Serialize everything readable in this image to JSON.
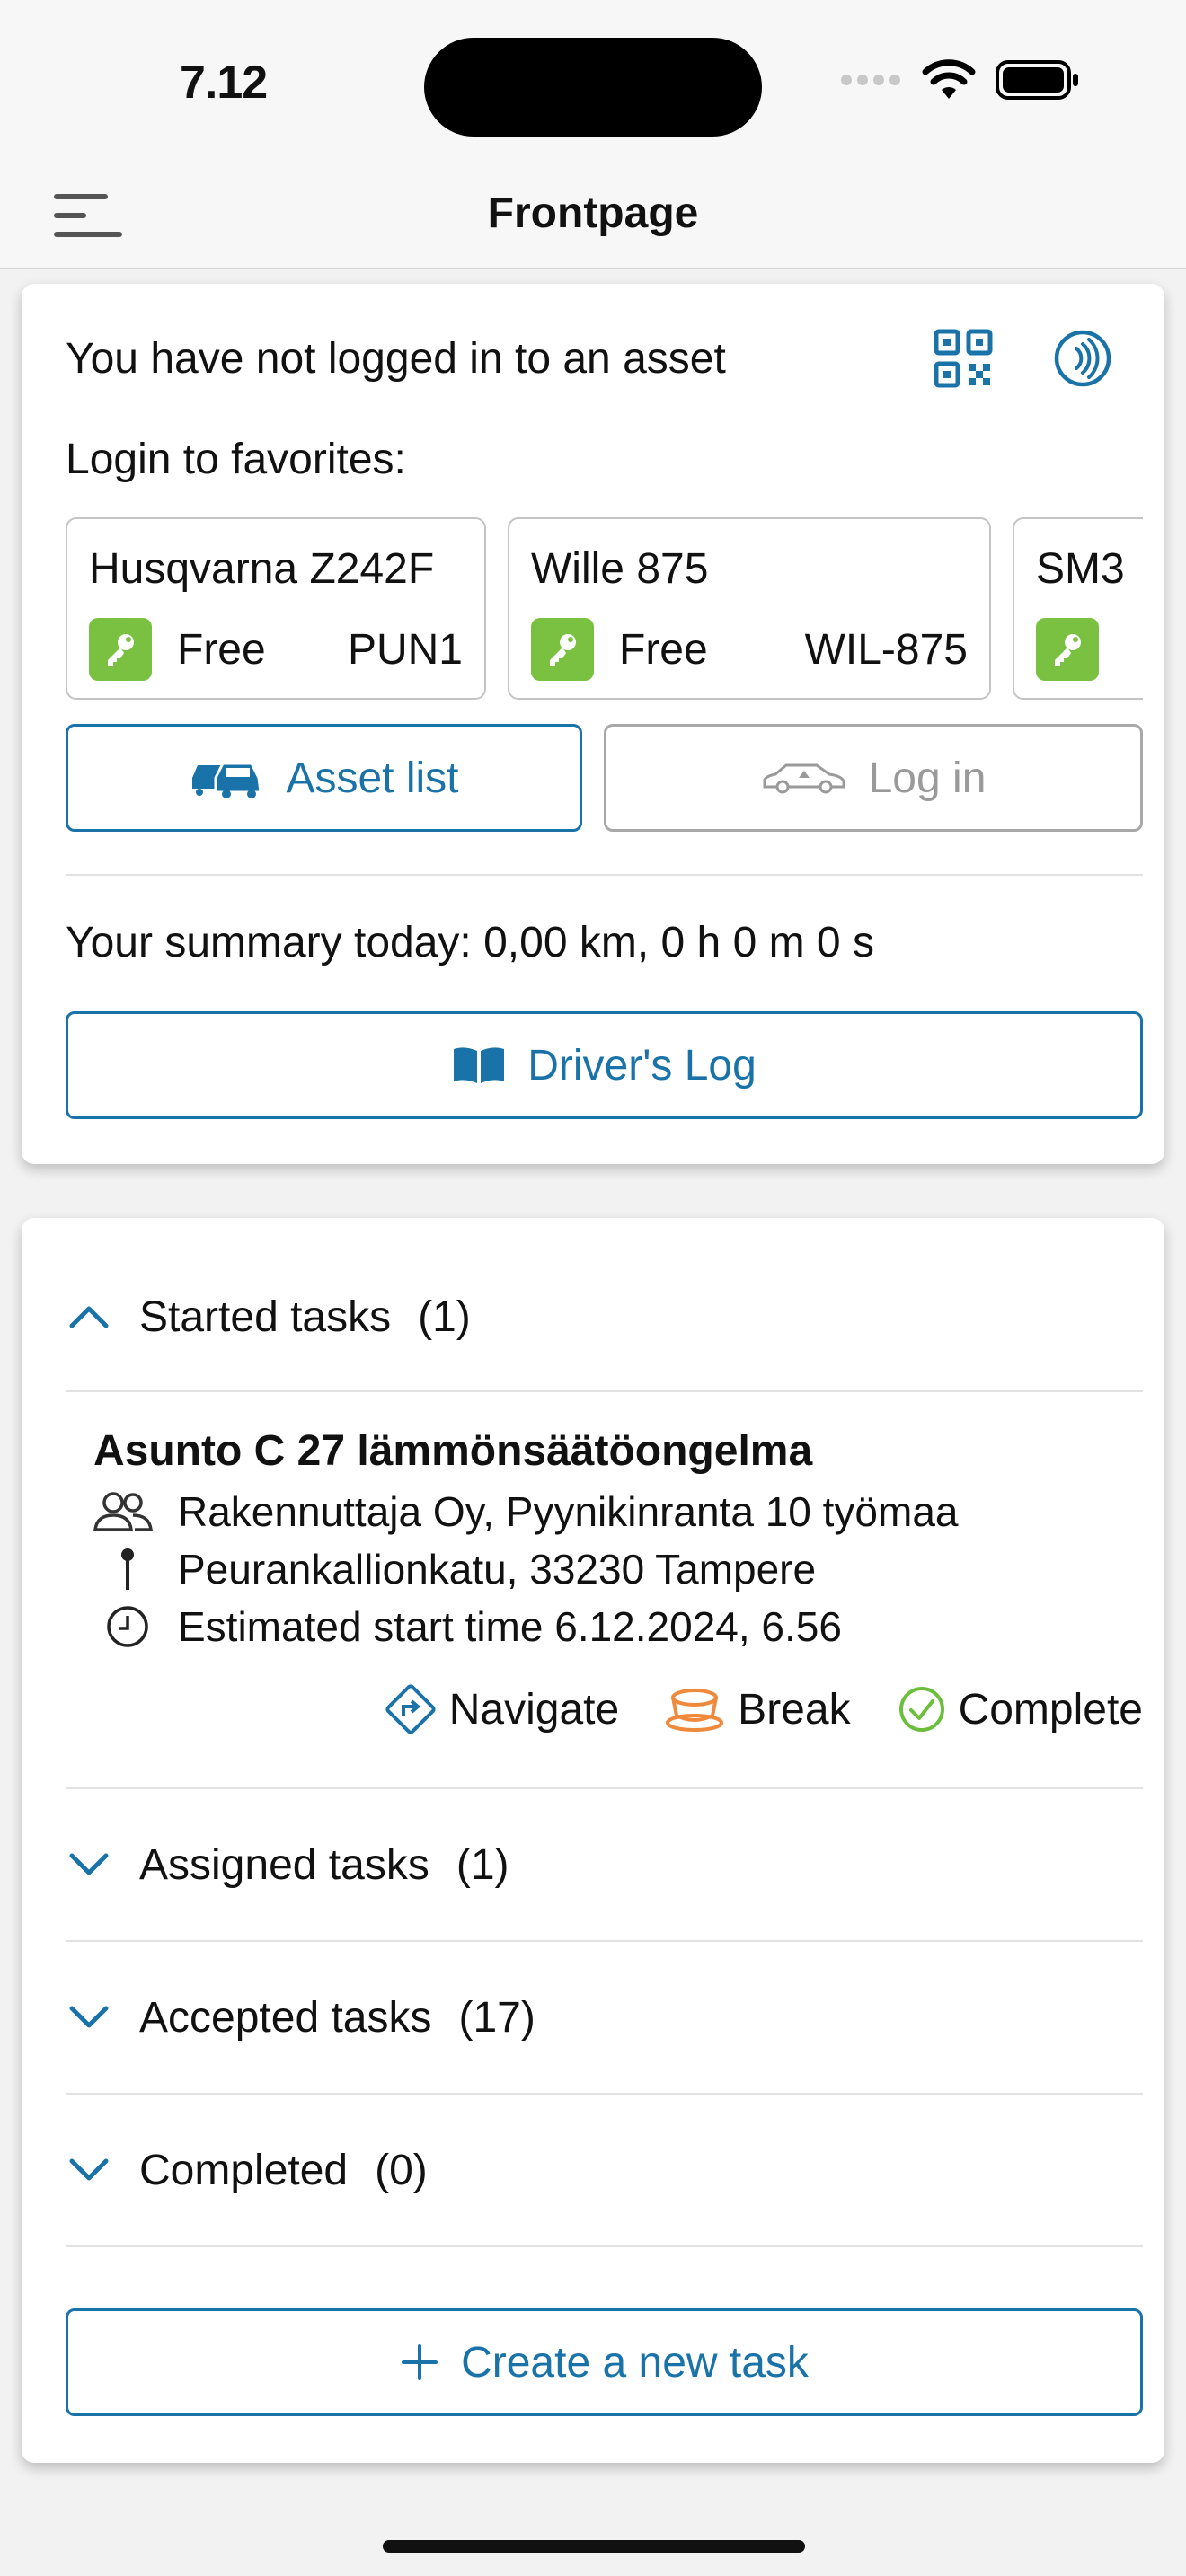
{
  "status_bar": {
    "time": "7.12"
  },
  "nav": {
    "title": "Frontpage"
  },
  "asset_card": {
    "status_text": "You have not logged in to an asset",
    "favorites_label": "Login to favorites:",
    "favorites": [
      {
        "name": "Husqvarna Z242F",
        "state": "Free",
        "plate": "PUN1"
      },
      {
        "name": "Wille 875",
        "state": "Free",
        "plate": "WIL-875"
      },
      {
        "name": "SM3",
        "state": "",
        "plate": ""
      }
    ],
    "asset_list_label": "Asset list",
    "login_label": "Log in",
    "summary": "Your summary today: 0,00 km, 0 h 0 m 0 s",
    "drivers_log_label": "Driver's Log"
  },
  "tasks_card": {
    "sections": [
      {
        "label": "Started tasks",
        "count": "(1)"
      },
      {
        "label": "Assigned tasks",
        "count": "(1)"
      },
      {
        "label": "Accepted tasks",
        "count": "(17)"
      },
      {
        "label": "Completed",
        "count": "(0)"
      }
    ],
    "task": {
      "title": "Asunto C 27 lämmönsäätöongelma",
      "customer": "Rakennuttaja Oy, Pyynikinranta 10 työmaa",
      "address": "Peurankallionkatu, 33230 Tampere",
      "start_time": "Estimated start time 6.12.2024, 6.56"
    },
    "actions": {
      "navigate": "Navigate",
      "break": "Break",
      "complete": "Complete"
    },
    "create_label": "Create a new task"
  },
  "colors": {
    "accent": "#1a73a8",
    "key_green": "#7ac142",
    "break_orange": "#ef8a3c",
    "complete_green": "#6cbf3c"
  }
}
